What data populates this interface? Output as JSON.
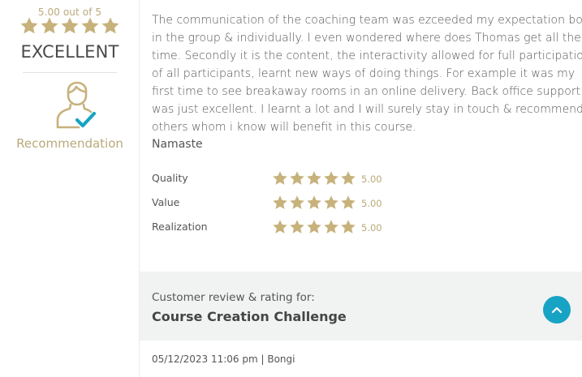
{
  "summary": {
    "score_text": "5.00 out of 5",
    "stars": 5,
    "rating_word": "EXCELLENT",
    "recommendation_label": "Recommendation"
  },
  "review": {
    "lines": [
      "The communication of the coaching team was ezceeded my expectation both",
      "in the group & individually. I even wondered where does Thomas get all the",
      "time. Secondly it is the content, the interactivity allowed for full participation",
      "of all participants, learnt new ways of doing things. For example it was my",
      "first time to see breakaway rooms in an online delivery. Back office support",
      "was just excellent. I learnt a lot and I will surely stay in touch & recommend to",
      "others whom i know will benefit in this course."
    ],
    "signoff": "Namaste"
  },
  "criteria": [
    {
      "label": "Quality",
      "stars": 5,
      "value": "5.00"
    },
    {
      "label": "Value",
      "stars": 5,
      "value": "5.00"
    },
    {
      "label": "Realization",
      "stars": 5,
      "value": "5.00"
    }
  ],
  "meta": {
    "caption": "Customer review & rating for:",
    "course": "Course Creation Challenge",
    "scroll_up_icon": "chevron-up-icon"
  },
  "footer": {
    "date_author": "05/12/2023 11:06 pm | Bongi"
  },
  "colors": {
    "star": "#c7b27c",
    "accent_gold": "#b9a97a",
    "teal": "#17a3c4",
    "band_bg": "#f1f2f2"
  }
}
